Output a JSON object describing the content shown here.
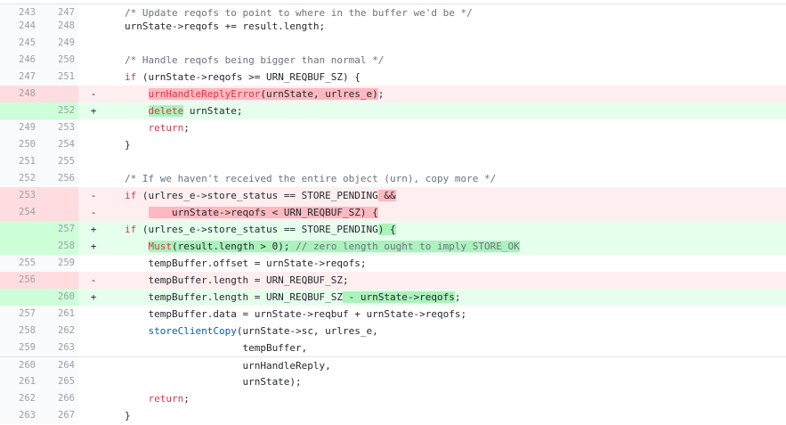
{
  "lines": [
    {
      "type": "ctx",
      "old": "243",
      "new": "247",
      "marker": "",
      "code": "/* Update reqofs to point to where in the buffer we'd be */"
    },
    {
      "type": "ctx",
      "old": "244",
      "new": "248",
      "marker": "",
      "code": "urnState->reqofs += result.length;"
    },
    {
      "type": "ctx",
      "old": "245",
      "new": "249",
      "marker": "",
      "code": ""
    },
    {
      "type": "ctx",
      "old": "246",
      "new": "250",
      "marker": "",
      "code": "/* Handle reqofs being bigger than normal */"
    },
    {
      "type": "ctx",
      "old": "247",
      "new": "251",
      "marker": "",
      "code": "if (urnState->reqofs >= URN_REQBUF_SZ) {"
    },
    {
      "type": "del",
      "old": "248",
      "new": "",
      "marker": "-",
      "code": "    urnHandleReplyError(urnState, urlres_e);"
    },
    {
      "type": "add",
      "old": "",
      "new": "252",
      "marker": "+",
      "code": "    delete urnState;"
    },
    {
      "type": "ctx",
      "old": "249",
      "new": "253",
      "marker": "",
      "code": "    return;"
    },
    {
      "type": "ctx",
      "old": "250",
      "new": "254",
      "marker": "",
      "code": "}"
    },
    {
      "type": "ctx",
      "old": "251",
      "new": "255",
      "marker": "",
      "code": ""
    },
    {
      "type": "ctx",
      "old": "252",
      "new": "256",
      "marker": "",
      "code": "/* If we haven't received the entire object (urn), copy more */"
    },
    {
      "type": "del",
      "old": "253",
      "new": "",
      "marker": "-",
      "code": "if (urlres_e->store_status == STORE_PENDING &&"
    },
    {
      "type": "del",
      "old": "254",
      "new": "",
      "marker": "-",
      "code": "        urnState->reqofs < URN_REQBUF_SZ) {"
    },
    {
      "type": "add",
      "old": "",
      "new": "257",
      "marker": "+",
      "code": "if (urlres_e->store_status == STORE_PENDING) {"
    },
    {
      "type": "add",
      "old": "",
      "new": "258",
      "marker": "+",
      "code": "    Must(result.length > 0); // zero length ought to imply STORE_OK"
    },
    {
      "type": "ctx",
      "old": "255",
      "new": "259",
      "marker": "",
      "code": "    tempBuffer.offset = urnState->reqofs;"
    },
    {
      "type": "del",
      "old": "256",
      "new": "",
      "marker": "-",
      "code": "    tempBuffer.length = URN_REQBUF_SZ;"
    },
    {
      "type": "add",
      "old": "",
      "new": "260",
      "marker": "+",
      "code": "    tempBuffer.length = URN_REQBUF_SZ - urnState->reqofs;"
    },
    {
      "type": "ctx",
      "old": "257",
      "new": "261",
      "marker": "",
      "code": "    tempBuffer.data = urnState->reqbuf + urnState->reqofs;"
    },
    {
      "type": "ctx",
      "old": "258",
      "new": "262",
      "marker": "",
      "code": "    storeClientCopy(urnState->sc, urlres_e,"
    },
    {
      "type": "ctx",
      "old": "259",
      "new": "263",
      "marker": "",
      "code": "                    tempBuffer,"
    },
    {
      "type": "ctx",
      "old": "260",
      "new": "264",
      "marker": "",
      "code": "                    urnHandleReply,"
    },
    {
      "type": "ctx",
      "old": "261",
      "new": "265",
      "marker": "",
      "code": "                    urnState);"
    },
    {
      "type": "ctx",
      "old": "262",
      "new": "266",
      "marker": "",
      "code": "    return;"
    },
    {
      "type": "ctx",
      "old": "263",
      "new": "267",
      "marker": "",
      "code": "}"
    }
  ]
}
